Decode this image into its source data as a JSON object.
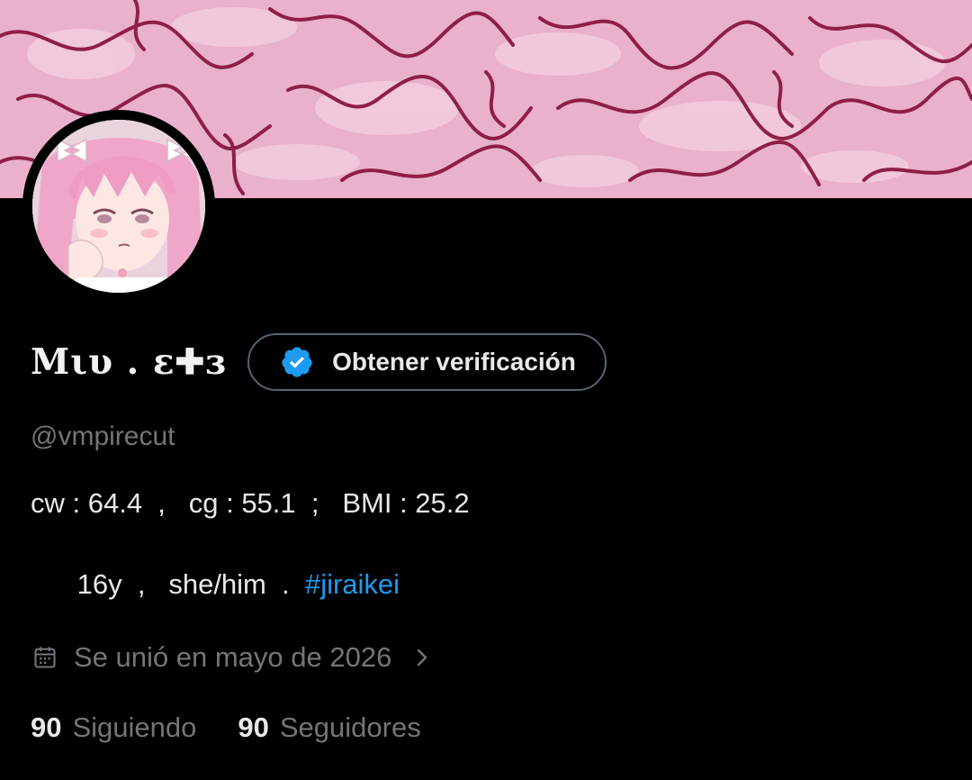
{
  "banner": {
    "description_icon": "pink-brain-texture-image"
  },
  "avatar": {
    "description_icon": "pink-hair-anime-girl-avatar"
  },
  "profile": {
    "display_name": "Mιυ . ɛ✚ɜ",
    "verify_button_label": "Obtener verificación",
    "verify_icon": "verified-badge-icon",
    "handle": "@vmpirecut",
    "bio_line1": "cw : 64.4  ,   cg : 55.1  ;   BMI : 25.2",
    "bio_line2_prefix": "      16y  ,   she/him  .  ",
    "bio_hashtag": "#jiraikei",
    "joined_icon": "calendar-icon",
    "joined_text": "Se unió en mayo de 2026",
    "joined_chevron": "chevron-right-icon"
  },
  "stats": {
    "following_count": "90",
    "following_label": "Siguiendo",
    "followers_count": "90",
    "followers_label": "Seguidores"
  },
  "colors": {
    "background": "#000000",
    "text_primary": "#e7e9ea",
    "text_secondary": "#71767b",
    "link": "#1d9bf0",
    "verify_badge": "#1d9bf0",
    "button_border": "#536471",
    "banner_base": "#e7a9c6",
    "banner_lines": "#8e1f47"
  }
}
